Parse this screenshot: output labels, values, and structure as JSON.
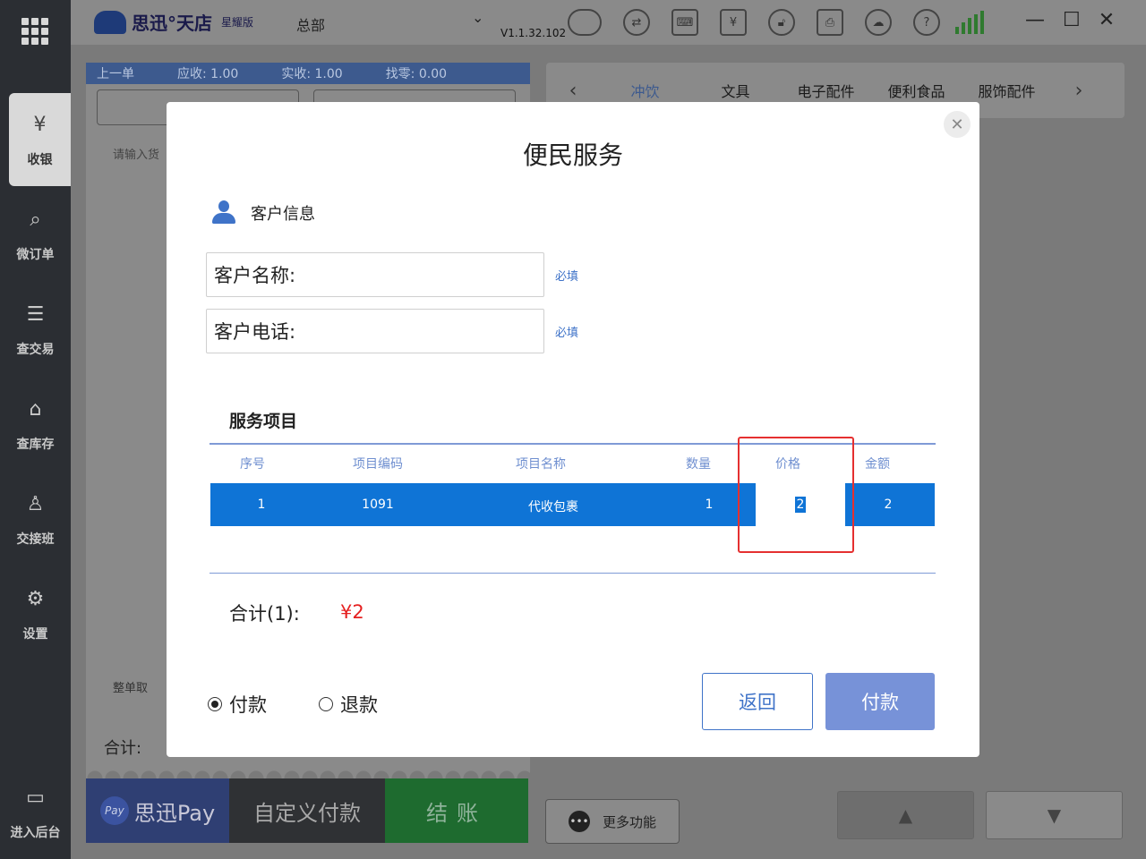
{
  "sidebar": {
    "items": [
      {
        "label": "收银",
        "icon": "cash-register-icon",
        "glyph": "¥"
      },
      {
        "label": "微订单",
        "icon": "order-icon",
        "glyph": "⌕"
      },
      {
        "label": "查交易",
        "icon": "transaction-icon",
        "glyph": "☰"
      },
      {
        "label": "查库存",
        "icon": "inventory-icon",
        "glyph": "⌂"
      },
      {
        "label": "交接班",
        "icon": "shift-handover-icon",
        "glyph": "♙"
      },
      {
        "label": "设置",
        "icon": "settings-icon",
        "glyph": "⚙"
      },
      {
        "label": "进入后台",
        "icon": "backend-icon",
        "glyph": "▭"
      }
    ]
  },
  "topbar": {
    "brand": "思迅°天店",
    "edition": "星耀版",
    "store": "总部",
    "version": "V1.1.32.102"
  },
  "cart": {
    "header": {
      "prev": "上一单",
      "receivable": "应收:  1.00",
      "received": "实收:  1.00",
      "change": "找零:  0.00"
    },
    "search_placeholder": "请输入货",
    "clear_label": "整单取",
    "total_label": "合计:"
  },
  "paybar": {
    "spay_badge": "Pay",
    "spay_label": "思迅Pay",
    "custom_label": "自定义付款",
    "checkout_label": "结账"
  },
  "categories": {
    "items": [
      "冲饮",
      "文具",
      "电子配件",
      "便利食品",
      "服饰配件"
    ],
    "active_index": 0
  },
  "bottom": {
    "more_label": "更多功能"
  },
  "modal": {
    "title": "便民服务",
    "customer_section": "客户信息",
    "name_label": "客户名称:",
    "phone_label": "客户电话:",
    "required": "必填",
    "service_section": "服务项目",
    "columns": [
      "序号",
      "项目编码",
      "项目名称",
      "数量",
      "价格",
      "金额"
    ],
    "row": {
      "index": "1",
      "code": "1091",
      "name": "代收包裹",
      "qty": "1",
      "price": "2",
      "amount": "2"
    },
    "sum_label": "合计(1):",
    "sum_value": "¥2",
    "mode_pay": "付款",
    "mode_refund": "退款",
    "back_label": "返回",
    "pay_label": "付款"
  },
  "colors": {
    "accent": "#3f73c8",
    "row_selected": "#0f74d6",
    "sum_red": "#e52020",
    "highlight": "#e53030"
  }
}
